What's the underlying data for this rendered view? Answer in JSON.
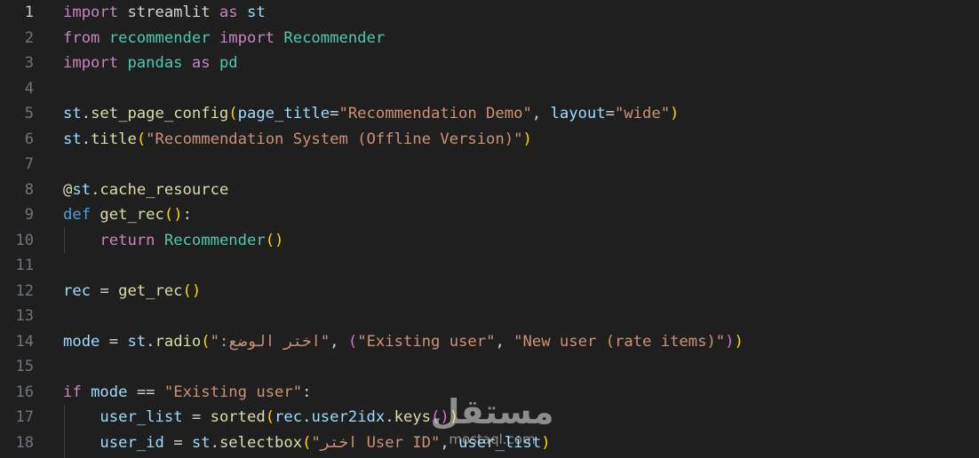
{
  "editor": {
    "active_line": 1,
    "lines": [
      {
        "number": "1",
        "tokens": [
          {
            "t": "import",
            "c": "kw"
          },
          {
            "t": " streamlit ",
            "c": "op"
          },
          {
            "t": "as",
            "c": "kw"
          },
          {
            "t": " st",
            "c": "var"
          }
        ]
      },
      {
        "number": "2",
        "tokens": [
          {
            "t": "from",
            "c": "kw"
          },
          {
            "t": " recommender ",
            "c": "cls"
          },
          {
            "t": "import",
            "c": "kw"
          },
          {
            "t": " Recommender",
            "c": "cls"
          }
        ]
      },
      {
        "number": "3",
        "tokens": [
          {
            "t": "import",
            "c": "kw"
          },
          {
            "t": " pandas ",
            "c": "cls"
          },
          {
            "t": "as",
            "c": "kw"
          },
          {
            "t": " pd",
            "c": "cls"
          }
        ]
      },
      {
        "number": "4",
        "tokens": []
      },
      {
        "number": "5",
        "tokens": [
          {
            "t": "st",
            "c": "var"
          },
          {
            "t": ".",
            "c": "op"
          },
          {
            "t": "set_page_config",
            "c": "fn"
          },
          {
            "t": "(",
            "c": "p1"
          },
          {
            "t": "page_title",
            "c": "var"
          },
          {
            "t": "=",
            "c": "op"
          },
          {
            "t": "\"Recommendation Demo\"",
            "c": "str"
          },
          {
            "t": ", ",
            "c": "op"
          },
          {
            "t": "layout",
            "c": "var"
          },
          {
            "t": "=",
            "c": "op"
          },
          {
            "t": "\"wide\"",
            "c": "str"
          },
          {
            "t": ")",
            "c": "p1"
          }
        ]
      },
      {
        "number": "6",
        "tokens": [
          {
            "t": "st",
            "c": "var"
          },
          {
            "t": ".",
            "c": "op"
          },
          {
            "t": "title",
            "c": "fn"
          },
          {
            "t": "(",
            "c": "p1"
          },
          {
            "t": "\"Recommendation System (Offline Version)\"",
            "c": "str"
          },
          {
            "t": ")",
            "c": "p1"
          }
        ]
      },
      {
        "number": "7",
        "tokens": []
      },
      {
        "number": "8",
        "tokens": [
          {
            "t": "@",
            "c": "dec"
          },
          {
            "t": "st",
            "c": "var"
          },
          {
            "t": ".",
            "c": "op"
          },
          {
            "t": "cache_resource",
            "c": "fn"
          }
        ]
      },
      {
        "number": "9",
        "tokens": [
          {
            "t": "def",
            "c": "kwb"
          },
          {
            "t": " ",
            "c": "op"
          },
          {
            "t": "get_rec",
            "c": "fn"
          },
          {
            "t": "(",
            "c": "p1"
          },
          {
            "t": ")",
            "c": "p1"
          },
          {
            "t": ":",
            "c": "op"
          }
        ]
      },
      {
        "number": "10",
        "tokens": [
          {
            "t": "    ",
            "c": "op"
          },
          {
            "t": "return",
            "c": "kw"
          },
          {
            "t": " ",
            "c": "op"
          },
          {
            "t": "Recommender",
            "c": "cls"
          },
          {
            "t": "(",
            "c": "p1"
          },
          {
            "t": ")",
            "c": "p1"
          }
        ]
      },
      {
        "number": "11",
        "tokens": []
      },
      {
        "number": "12",
        "tokens": [
          {
            "t": "rec",
            "c": "var"
          },
          {
            "t": " = ",
            "c": "op"
          },
          {
            "t": "get_rec",
            "c": "fn"
          },
          {
            "t": "(",
            "c": "p1"
          },
          {
            "t": ")",
            "c": "p1"
          }
        ]
      },
      {
        "number": "13",
        "tokens": []
      },
      {
        "number": "14",
        "tokens": [
          {
            "t": "mode",
            "c": "var"
          },
          {
            "t": " = ",
            "c": "op"
          },
          {
            "t": "st",
            "c": "var"
          },
          {
            "t": ".",
            "c": "op"
          },
          {
            "t": "radio",
            "c": "fn"
          },
          {
            "t": "(",
            "c": "p1"
          },
          {
            "t": "\":اختر الوضع\"",
            "c": "str"
          },
          {
            "t": ", ",
            "c": "op"
          },
          {
            "t": "(",
            "c": "p2"
          },
          {
            "t": "\"Existing user\"",
            "c": "str"
          },
          {
            "t": ", ",
            "c": "op"
          },
          {
            "t": "\"New user (rate items)\"",
            "c": "str"
          },
          {
            "t": ")",
            "c": "p2"
          },
          {
            "t": ")",
            "c": "p1"
          }
        ]
      },
      {
        "number": "15",
        "tokens": []
      },
      {
        "number": "16",
        "tokens": [
          {
            "t": "if",
            "c": "kw"
          },
          {
            "t": " ",
            "c": "op"
          },
          {
            "t": "mode",
            "c": "var"
          },
          {
            "t": " == ",
            "c": "op"
          },
          {
            "t": "\"Existing user\"",
            "c": "str"
          },
          {
            "t": ":",
            "c": "op"
          }
        ]
      },
      {
        "number": "17",
        "tokens": [
          {
            "t": "    ",
            "c": "op"
          },
          {
            "t": "user_list",
            "c": "var"
          },
          {
            "t": " = ",
            "c": "op"
          },
          {
            "t": "sorted",
            "c": "fn"
          },
          {
            "t": "(",
            "c": "p1"
          },
          {
            "t": "rec",
            "c": "var"
          },
          {
            "t": ".",
            "c": "op"
          },
          {
            "t": "user2idx",
            "c": "var"
          },
          {
            "t": ".",
            "c": "op"
          },
          {
            "t": "keys",
            "c": "fn"
          },
          {
            "t": "(",
            "c": "p2"
          },
          {
            "t": ")",
            "c": "p2"
          },
          {
            "t": ")",
            "c": "p1"
          }
        ]
      },
      {
        "number": "18",
        "tokens": [
          {
            "t": "    ",
            "c": "op"
          },
          {
            "t": "user_id",
            "c": "var"
          },
          {
            "t": " = ",
            "c": "op"
          },
          {
            "t": "st",
            "c": "var"
          },
          {
            "t": ".",
            "c": "op"
          },
          {
            "t": "selectbox",
            "c": "fn"
          },
          {
            "t": "(",
            "c": "p1"
          },
          {
            "t": "\"اختر User ID\"",
            "c": "str"
          },
          {
            "t": ", ",
            "c": "op"
          },
          {
            "t": "user_list",
            "c": "var"
          },
          {
            "t": ")",
            "c": "p1"
          }
        ]
      }
    ]
  },
  "watermark": {
    "arabic": "مستقل",
    "latin": "mostaql.com"
  }
}
